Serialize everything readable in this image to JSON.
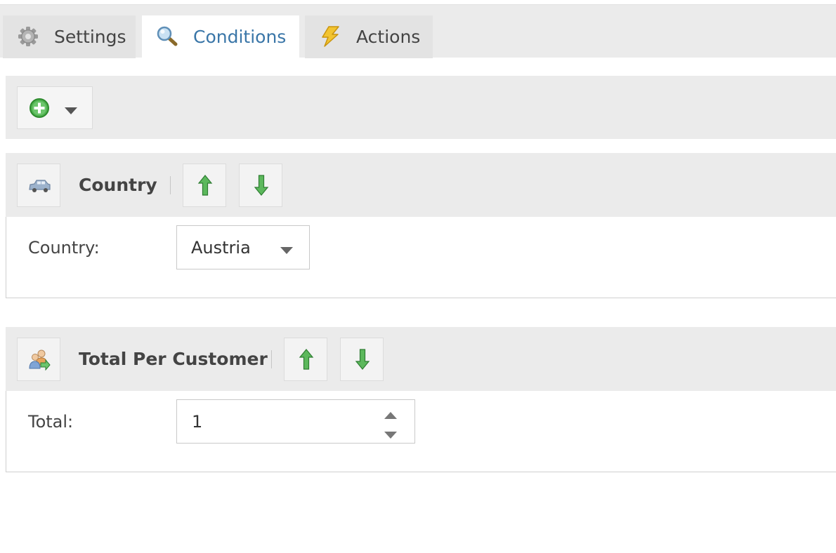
{
  "tabs": [
    {
      "label": "Settings",
      "icon": "gear-icon",
      "active": false
    },
    {
      "label": "Conditions",
      "icon": "magnifier-icon",
      "active": true
    },
    {
      "label": "Actions",
      "icon": "lightning-icon",
      "active": false
    }
  ],
  "toolbar": {
    "add_icon": "add-icon",
    "dropdown_icon": "caret-down-icon"
  },
  "conditions": [
    {
      "title": "Country",
      "icon": "car-icon",
      "field_label": "Country:",
      "value": "Austria"
    },
    {
      "title": "Total Per Customer",
      "icon": "customer-icon",
      "field_label": "Total:",
      "value": "1"
    }
  ],
  "colors": {
    "active_tab_text": "#3a76a8",
    "panel_bg": "#ebebeb",
    "arrow_green": "#3b9a3b"
  }
}
